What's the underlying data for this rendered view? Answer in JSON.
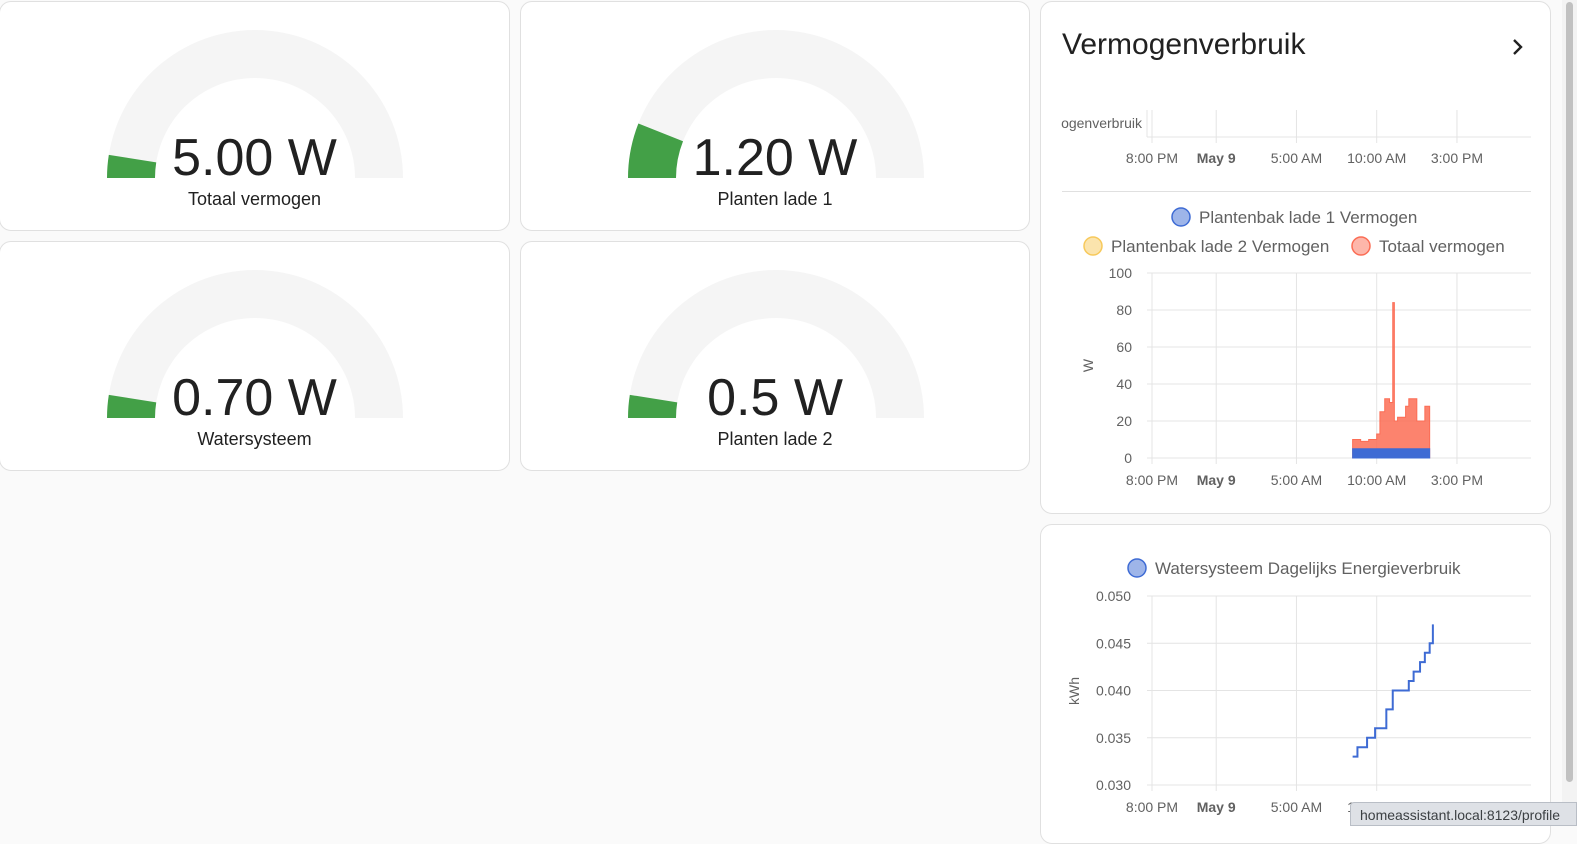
{
  "gauges": [
    {
      "value": "5.00 W",
      "name": "Totaal vermogen",
      "fraction": 0.05
    },
    {
      "value": "1.20 W",
      "name": "Planten lade 1",
      "fraction": 0.12
    },
    {
      "value": "0.70 W",
      "name": "Watersysteem",
      "fraction": 0.05
    },
    {
      "value": "0.5 W",
      "name": "Planten lade 2",
      "fraction": 0.05
    }
  ],
  "colors": {
    "gauge_fill": "#43a047",
    "gauge_track": "#f5f5f5",
    "series_lade1": "#3e6bd4",
    "series_lade2": "#f7c95b",
    "series_totaal": "#fb6d55",
    "water": "#3e6bd4"
  },
  "history": {
    "title": "Vermogenverbruik",
    "chevron_icon": "chevron-right-icon",
    "collapsed_label": "ogenverbruik"
  },
  "chart_data": [
    {
      "type": "line",
      "title": "",
      "xlabel": "",
      "ylabel": "",
      "x_ticks": [
        "8:00 PM",
        "May 9",
        "5:00 AM",
        "10:00 AM",
        "3:00 PM"
      ],
      "series": [],
      "note_label": "ogenverbruik"
    },
    {
      "type": "area",
      "ylabel": "W",
      "ylim": [
        0,
        100
      ],
      "y_ticks": [
        "100",
        "80",
        "60",
        "40",
        "20",
        "0"
      ],
      "x_ticks": [
        "8:00 PM",
        "May 9",
        "5:00 AM",
        "10:00 AM",
        "3:00 PM"
      ],
      "legend": [
        "Plantenbak lade 1 Vermogen",
        "Plantenbak lade 2 Vermogen",
        "Totaal vermogen"
      ],
      "x_hours": [
        12.5,
        13,
        13.5,
        14,
        14.2,
        14.5,
        14.8,
        15,
        15.1,
        15.3,
        15.5,
        15.8,
        16,
        16.5,
        17,
        17.3
      ],
      "series": [
        {
          "name": "Plantenbak lade 1 Vermogen",
          "values": [
            5,
            5,
            5,
            5,
            5,
            5,
            5,
            5,
            5,
            5,
            5,
            5,
            5,
            5,
            5,
            5
          ]
        },
        {
          "name": "Plantenbak lade 2 Vermogen",
          "values": [
            0.5,
            0.5,
            0.5,
            0.5,
            0.5,
            0.5,
            0.5,
            0.5,
            0.5,
            0.5,
            0.5,
            0.5,
            0.5,
            0.5,
            0.5,
            0.5
          ]
        },
        {
          "name": "Totaal vermogen",
          "values": [
            10,
            9,
            10,
            13,
            25,
            32,
            30,
            84,
            20,
            22,
            22,
            28,
            32,
            20,
            28,
            27
          ]
        }
      ]
    },
    {
      "type": "line",
      "ylabel": "kWh",
      "ylim": [
        0.03,
        0.05
      ],
      "y_ticks": [
        "0.050",
        "0.045",
        "0.040",
        "0.035",
        "0.030"
      ],
      "x_ticks": [
        "8:00 PM",
        "May 9",
        "5:00 AM",
        "10:00 AM"
      ],
      "legend": [
        "Watersysteem Dagelijks Energieverbruik"
      ],
      "x_hours": [
        12.5,
        12.8,
        13.4,
        13.9,
        14.6,
        15,
        15.3,
        16,
        16.3,
        16.7,
        17,
        17.3,
        17.5
      ],
      "series": [
        {
          "name": "Watersysteem Dagelijks Energieverbruik",
          "values": [
            0.033,
            0.034,
            0.035,
            0.036,
            0.038,
            0.04,
            0.04,
            0.041,
            0.042,
            0.043,
            0.044,
            0.045,
            0.047
          ]
        }
      ]
    }
  ],
  "statusbar": {
    "url": "homeassistant.local:8123/profile"
  }
}
